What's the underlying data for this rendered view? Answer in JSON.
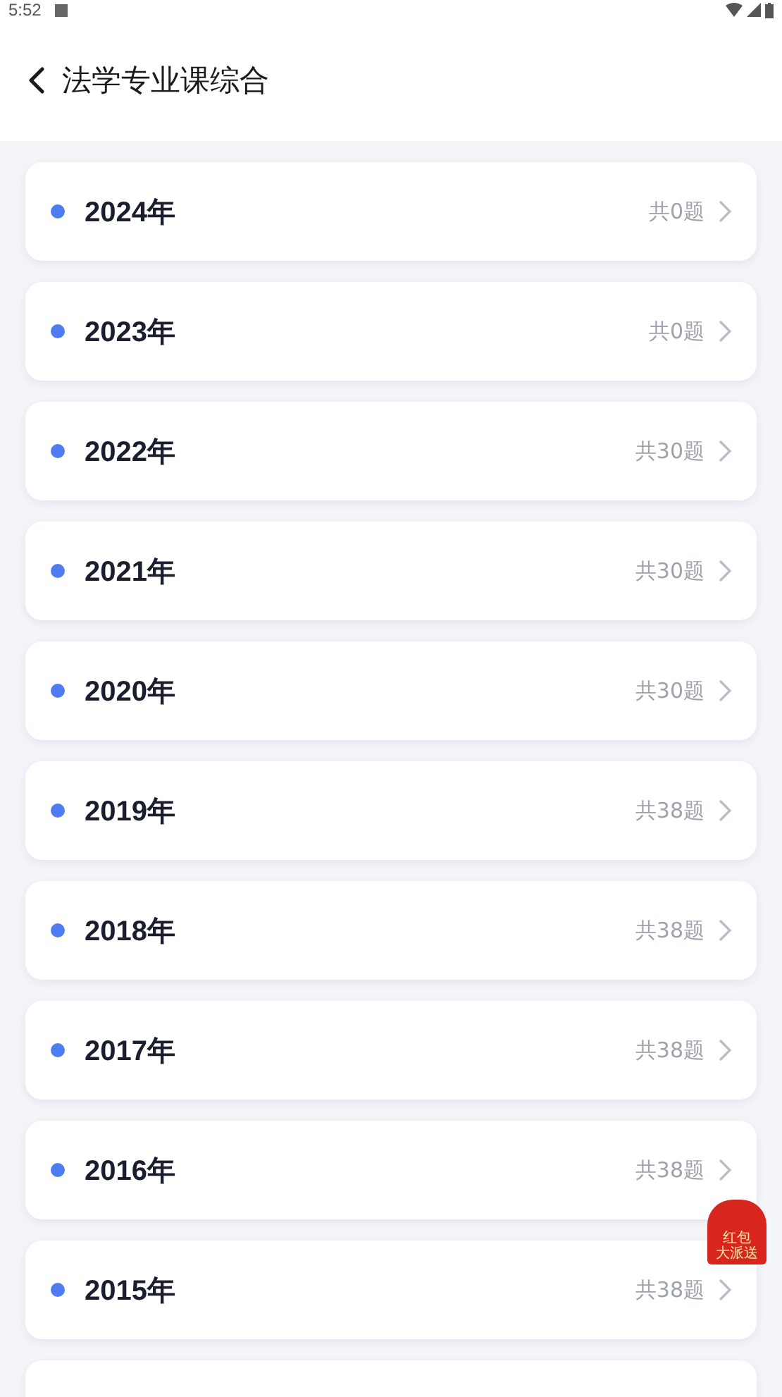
{
  "status_bar": {
    "time": "5:52"
  },
  "header": {
    "title": "法学专业课综合"
  },
  "years": [
    {
      "year": "2024年",
      "count": "共0题"
    },
    {
      "year": "2023年",
      "count": "共0题"
    },
    {
      "year": "2022年",
      "count": "共30题"
    },
    {
      "year": "2021年",
      "count": "共30题"
    },
    {
      "year": "2020年",
      "count": "共30题"
    },
    {
      "year": "2019年",
      "count": "共38题"
    },
    {
      "year": "2018年",
      "count": "共38题"
    },
    {
      "year": "2017年",
      "count": "共38题"
    },
    {
      "year": "2016年",
      "count": "共38题"
    },
    {
      "year": "2015年",
      "count": "共38题"
    }
  ],
  "promo_badge": {
    "line_1": "红包",
    "line_2": "大派送"
  }
}
